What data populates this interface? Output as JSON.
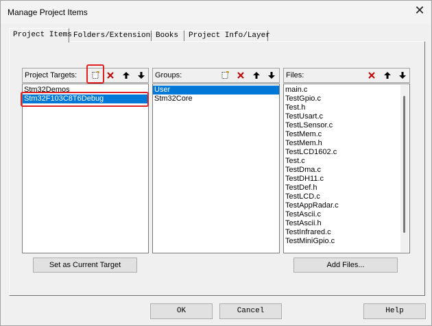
{
  "window": {
    "title": "Manage Project Items"
  },
  "tabs": [
    "Project Items",
    "Folders/Extensions",
    "Books",
    "Project Info/Layer"
  ],
  "targets": {
    "label": "Project Targets:",
    "items": [
      "Stm32Demos",
      "Stm32F103C8T6Debug"
    ],
    "button_label": "Set as Current Target"
  },
  "groups": {
    "label": "Groups:",
    "items": [
      "User",
      "Stm32Core"
    ]
  },
  "files": {
    "label": "Files:",
    "items": [
      "main.c",
      "TestGpio.c",
      "Test.h",
      "TestUsart.c",
      "TestLSensor.c",
      "TestMem.c",
      "TestMem.h",
      "TestLCD1602.c",
      "Test.c",
      "TestDma.c",
      "TestDH11.c",
      "TestDef.h",
      "TestLCD.c",
      "TestAppRadar.c",
      "TestAscii.c",
      "TestAscii.h",
      "TestInfrared.c",
      "TestMiniGpio.c"
    ],
    "button_label": "Add Files..."
  },
  "footer": {
    "ok": "OK",
    "cancel": "Cancel",
    "help": "Help"
  },
  "icons": [
    "new-item-icon",
    "delete-icon",
    "move-up-icon",
    "move-down-icon",
    "close-icon"
  ],
  "colors": {
    "selection": "#0078d7",
    "highlight_box": "#e02020",
    "delete_icon": "#c00000"
  }
}
